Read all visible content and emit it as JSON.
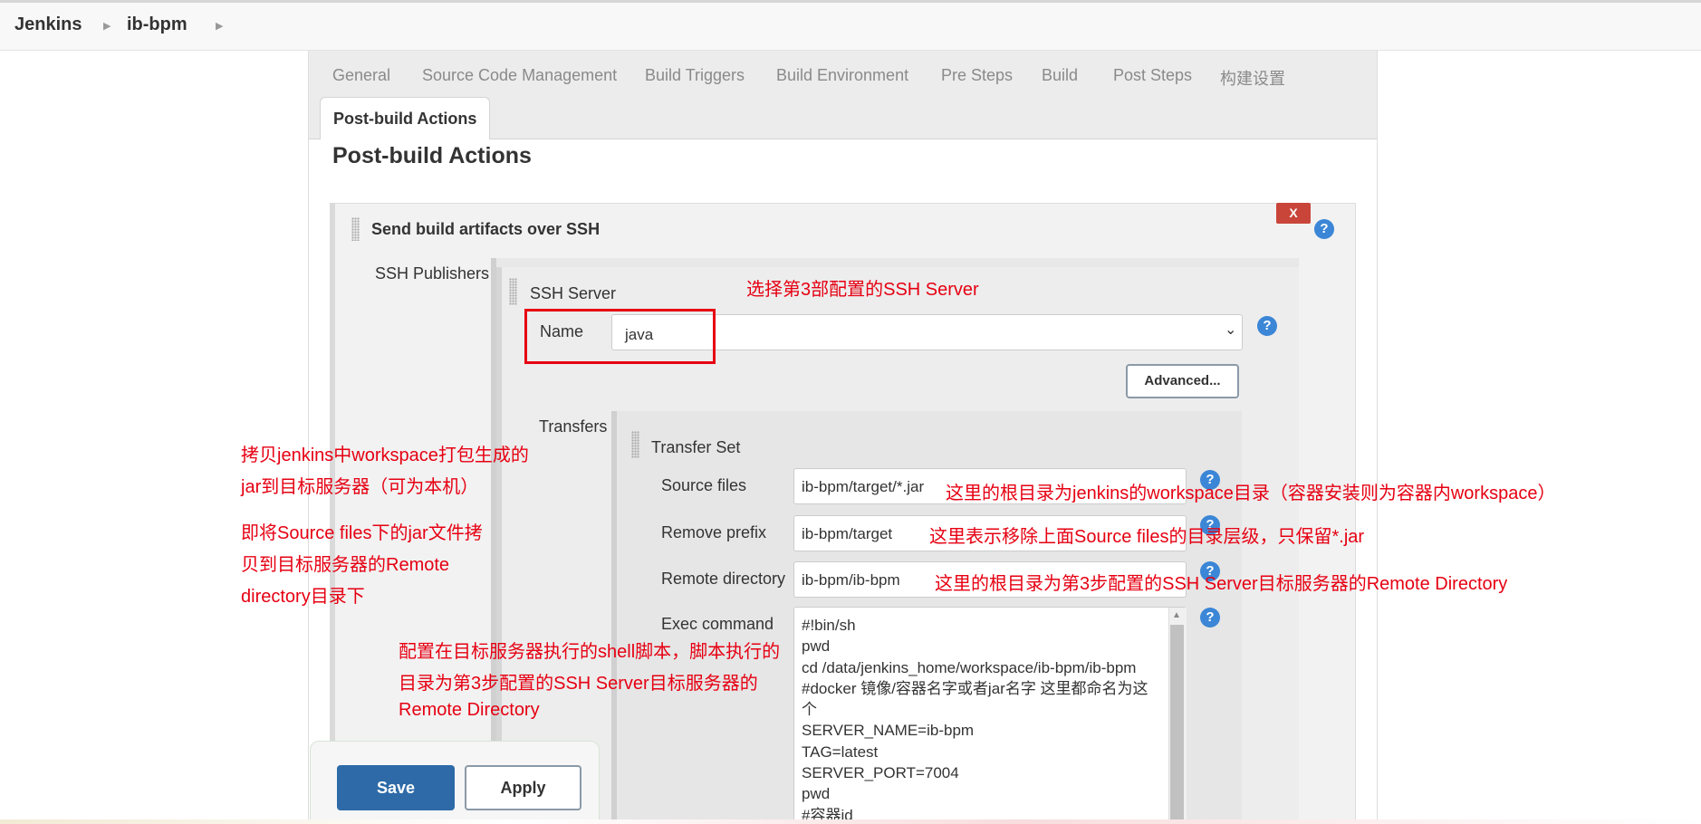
{
  "breadcrumb": {
    "root": "Jenkins",
    "job": "ib-bpm"
  },
  "tabs": [
    "General",
    "Source Code Management",
    "Build Triggers",
    "Build Environment",
    "Pre Steps",
    "Build",
    "Post Steps",
    "构建设置"
  ],
  "active_tab": "Post-build Actions",
  "page_title": "Post-build Actions",
  "block": {
    "title": "Send build artifacts over SSH",
    "delete_label": "X",
    "help": "?"
  },
  "ssh_publishers_label": "SSH Publishers",
  "ssh_server": {
    "label": "SSH Server",
    "name_label": "Name",
    "name_value": "java",
    "advanced_label": "Advanced..."
  },
  "transfers_label": "Transfers",
  "transfer_set": {
    "label": "Transfer Set",
    "source_files_label": "Source files",
    "source_files_value": "ib-bpm/target/*.jar",
    "remove_prefix_label": "Remove prefix",
    "remove_prefix_value": "ib-bpm/target",
    "remote_directory_label": "Remote directory",
    "remote_directory_value": "ib-bpm/ib-bpm",
    "exec_command_label": "Exec command",
    "exec_command_lines": [
      "#!bin/sh",
      "pwd",
      "cd /data/jenkins_home/workspace/ib-bpm/ib-bpm",
      "#docker 镜像/容器名字或者jar名字 这里都命名为这",
      "个",
      "SERVER_NAME=ib-bpm",
      "TAG=latest",
      "SERVER_PORT=7004",
      "pwd",
      "#容器id"
    ]
  },
  "annotations": {
    "select_server": "选择第3部配置的SSH Server",
    "copy_jar_1": "拷贝jenkins中workspace打包生成的",
    "copy_jar_2": "jar到目标服务器（可为本机）",
    "source_to_remote_1": "即将Source files下的jar文件拷",
    "source_to_remote_2": "贝到目标服务器的Remote",
    "source_to_remote_3": "directory目录下",
    "source_root": "这里的根目录为jenkins的workspace目录（容器安装则为容器内workspace）",
    "remove_prefix_note": "这里表示移除上面Source files的目录层级，只保留*.jar",
    "remote_root": "这里的根目录为第3步配置的SSH Server目标服务器的Remote Directory",
    "exec_note_1": "配置在目标服务器执行的shell脚本，脚本执行的",
    "exec_note_2": "目录为第3步配置的SSH Server目标服务器的",
    "exec_note_3": "Remote Directory"
  },
  "buttons": {
    "save": "Save",
    "apply": "Apply"
  },
  "colors": {
    "annotation_red": "#e60012",
    "save_blue": "#2e6aa8",
    "help_blue": "#3b86d6",
    "delete_red": "#c9453a"
  }
}
